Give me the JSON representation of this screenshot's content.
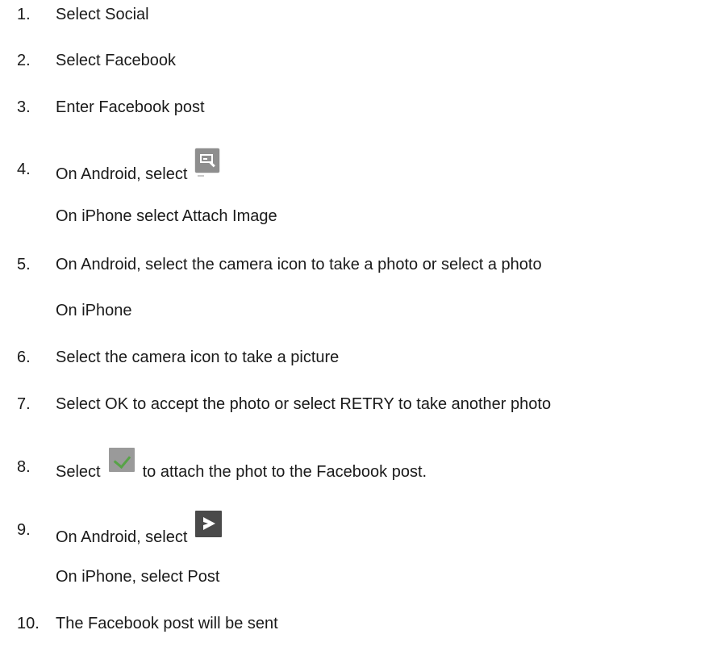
{
  "steps": [
    {
      "num": "1.",
      "text": "Select Social"
    },
    {
      "num": "2.",
      "text": "Select Facebook"
    },
    {
      "num": "3.",
      "text": "Enter Facebook post"
    },
    {
      "num": "4.",
      "text_before": "On Android, select",
      "icon": "image-edit-icon",
      "subtext": "On iPhone select Attach Image"
    },
    {
      "num": "5.",
      "text": "On Android, select the camera icon to take a photo or select a photo",
      "subtext": "On iPhone"
    },
    {
      "num": "6.",
      "text": "Select the camera icon to take a picture"
    },
    {
      "num": "7.",
      "text": "Select OK to accept the photo or select RETRY to take another photo"
    },
    {
      "num": "8.",
      "text_before": "Select",
      "icon": "check-icon",
      "text_after": "to attach the phot to the Facebook post."
    },
    {
      "num": "9.",
      "text_before": "On Android, select",
      "icon": "send-icon",
      "subtext": "On iPhone, select Post"
    },
    {
      "num": "10.",
      "text": "The Facebook post will be sent"
    }
  ]
}
